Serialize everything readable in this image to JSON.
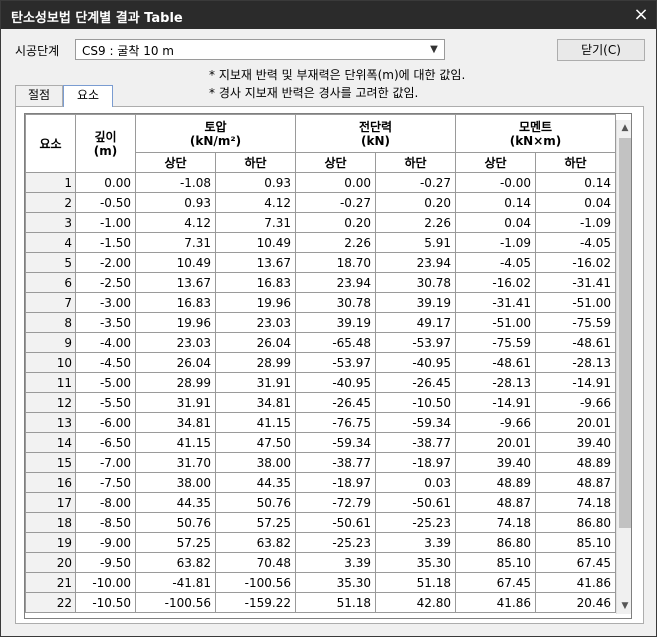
{
  "window": {
    "title": "탄소성보법 단계별 결과 Table",
    "close_icon": "×"
  },
  "stage": {
    "label": "시공단계",
    "selected": "CS9 : 굴착 10 m"
  },
  "close_button_label": "닫기(C)",
  "notes": [
    "* 지보재 반력 및 부재력은 단위폭(m)에 대한 값임.",
    "* 경사 지보재 반력은 경사를 고려한 값임."
  ],
  "tabs": [
    {
      "label": "절점",
      "active": false
    },
    {
      "label": "요소",
      "active": true
    }
  ],
  "table": {
    "headers": {
      "element": "요소",
      "depth": "깊이\n(m)",
      "earth_pressure": "토압\n(kN/m²)",
      "shear": "전단력\n(kN)",
      "moment": "모멘트\n(kN×m)",
      "top": "상단",
      "bottom": "하단"
    },
    "rows": [
      [
        "1",
        "0.00",
        "-1.08",
        "0.93",
        "0.00",
        "-0.27",
        "-0.00",
        "0.14"
      ],
      [
        "2",
        "-0.50",
        "0.93",
        "4.12",
        "-0.27",
        "0.20",
        "0.14",
        "0.04"
      ],
      [
        "3",
        "-1.00",
        "4.12",
        "7.31",
        "0.20",
        "2.26",
        "0.04",
        "-1.09"
      ],
      [
        "4",
        "-1.50",
        "7.31",
        "10.49",
        "2.26",
        "5.91",
        "-1.09",
        "-4.05"
      ],
      [
        "5",
        "-2.00",
        "10.49",
        "13.67",
        "18.70",
        "23.94",
        "-4.05",
        "-16.02"
      ],
      [
        "6",
        "-2.50",
        "13.67",
        "16.83",
        "23.94",
        "30.78",
        "-16.02",
        "-31.41"
      ],
      [
        "7",
        "-3.00",
        "16.83",
        "19.96",
        "30.78",
        "39.19",
        "-31.41",
        "-51.00"
      ],
      [
        "8",
        "-3.50",
        "19.96",
        "23.03",
        "39.19",
        "49.17",
        "-51.00",
        "-75.59"
      ],
      [
        "9",
        "-4.00",
        "23.03",
        "26.04",
        "-65.48",
        "-53.97",
        "-75.59",
        "-48.61"
      ],
      [
        "10",
        "-4.50",
        "26.04",
        "28.99",
        "-53.97",
        "-40.95",
        "-48.61",
        "-28.13"
      ],
      [
        "11",
        "-5.00",
        "28.99",
        "31.91",
        "-40.95",
        "-26.45",
        "-28.13",
        "-14.91"
      ],
      [
        "12",
        "-5.50",
        "31.91",
        "34.81",
        "-26.45",
        "-10.50",
        "-14.91",
        "-9.66"
      ],
      [
        "13",
        "-6.00",
        "34.81",
        "41.15",
        "-76.75",
        "-59.34",
        "-9.66",
        "20.01"
      ],
      [
        "14",
        "-6.50",
        "41.15",
        "47.50",
        "-59.34",
        "-38.77",
        "20.01",
        "39.40"
      ],
      [
        "15",
        "-7.00",
        "31.70",
        "38.00",
        "-38.77",
        "-18.97",
        "39.40",
        "48.89"
      ],
      [
        "16",
        "-7.50",
        "38.00",
        "44.35",
        "-18.97",
        "0.03",
        "48.89",
        "48.87"
      ],
      [
        "17",
        "-8.00",
        "44.35",
        "50.76",
        "-72.79",
        "-50.61",
        "48.87",
        "74.18"
      ],
      [
        "18",
        "-8.50",
        "50.76",
        "57.25",
        "-50.61",
        "-25.23",
        "74.18",
        "86.80"
      ],
      [
        "19",
        "-9.00",
        "57.25",
        "63.82",
        "-25.23",
        "3.39",
        "86.80",
        "85.10"
      ],
      [
        "20",
        "-9.50",
        "63.82",
        "70.48",
        "3.39",
        "35.30",
        "85.10",
        "67.45"
      ],
      [
        "21",
        "-10.00",
        "-41.81",
        "-100.56",
        "35.30",
        "51.18",
        "67.45",
        "41.86"
      ],
      [
        "22",
        "-10.50",
        "-100.56",
        "-159.22",
        "51.18",
        "42.80",
        "41.86",
        "20.46"
      ]
    ]
  }
}
